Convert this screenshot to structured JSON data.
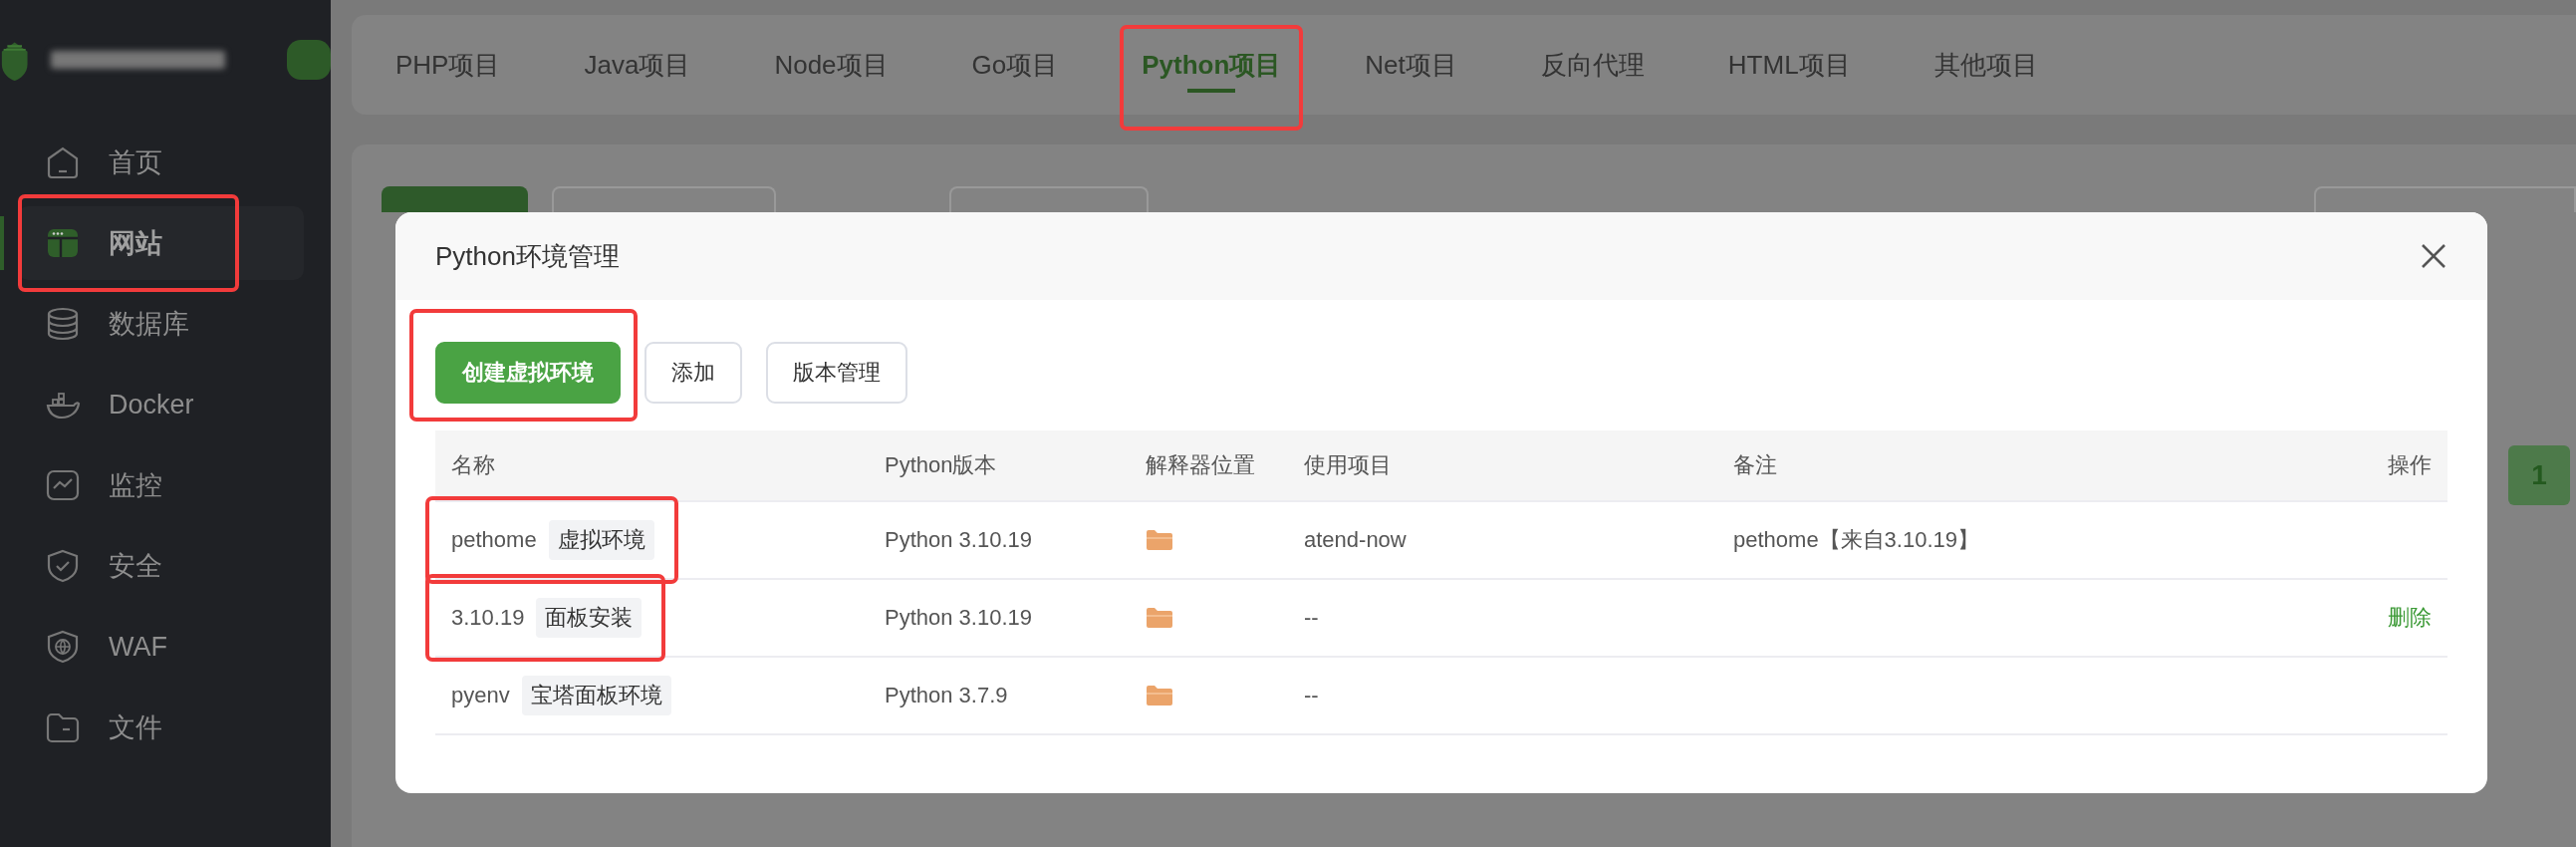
{
  "sidebar": {
    "items": [
      {
        "label": "首页",
        "selected": false,
        "highlighted": false
      },
      {
        "label": "网站",
        "selected": true,
        "highlighted": true
      },
      {
        "label": "数据库",
        "selected": false,
        "highlighted": false
      },
      {
        "label": "Docker",
        "selected": false,
        "highlighted": false
      },
      {
        "label": "监控",
        "selected": false,
        "highlighted": false
      },
      {
        "label": "安全",
        "selected": false,
        "highlighted": false
      },
      {
        "label": "WAF",
        "selected": false,
        "highlighted": false
      },
      {
        "label": "文件",
        "selected": false,
        "highlighted": false
      }
    ]
  },
  "tabs": [
    {
      "label": "PHP项目",
      "selected": false,
      "highlighted": false
    },
    {
      "label": "Java项目",
      "selected": false,
      "highlighted": false
    },
    {
      "label": "Node项目",
      "selected": false,
      "highlighted": false
    },
    {
      "label": "Go项目",
      "selected": false,
      "highlighted": false
    },
    {
      "label": "Python项目",
      "selected": true,
      "highlighted": true
    },
    {
      "label": "Net项目",
      "selected": false,
      "highlighted": false
    },
    {
      "label": "反向代理",
      "selected": false,
      "highlighted": false
    },
    {
      "label": "HTML项目",
      "selected": false,
      "highlighted": false
    },
    {
      "label": "其他项目",
      "selected": false,
      "highlighted": false
    }
  ],
  "pagination": [
    {
      "label": "1",
      "selected": true
    }
  ],
  "modal": {
    "title": "Python环境管理",
    "buttons": [
      {
        "label": "创建虚拟环境",
        "kind": "primary",
        "highlighted": true
      },
      {
        "label": "添加",
        "kind": "default",
        "highlighted": false
      },
      {
        "label": "版本管理",
        "kind": "default",
        "highlighted": false
      }
    ],
    "table": {
      "columns": [
        "名称",
        "Python版本",
        "解释器位置",
        "使用项目",
        "备注",
        "操作"
      ],
      "rows": [
        {
          "name": "pethome",
          "tag": "虚拟环境",
          "highlighted": true,
          "version": "Python 3.10.19",
          "project": "atend-now",
          "note": "pethome【来自3.10.19】"
        },
        {
          "name": "3.10.19",
          "tag": "面板安装",
          "highlighted": true,
          "version": "Python 3.10.19",
          "project": "--",
          "actions": [
            "删除"
          ]
        },
        {
          "name": "pyenv",
          "tag": "宝塔面板环境",
          "highlighted": false,
          "version": "Python 3.7.9",
          "project": "--"
        }
      ]
    }
  }
}
